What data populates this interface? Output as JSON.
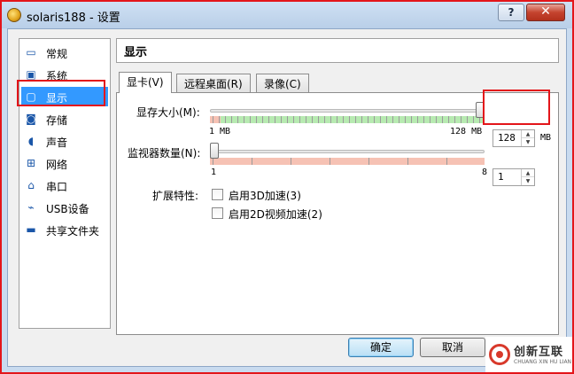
{
  "window": {
    "title": "solaris188 - 设置",
    "help_label": "?",
    "close_label": "✕"
  },
  "sidebar": {
    "items": [
      {
        "label": "常规",
        "icon": "general-icon"
      },
      {
        "label": "系统",
        "icon": "system-icon"
      },
      {
        "label": "显示",
        "icon": "display-icon"
      },
      {
        "label": "存储",
        "icon": "storage-icon"
      },
      {
        "label": "声音",
        "icon": "audio-icon"
      },
      {
        "label": "网络",
        "icon": "network-icon"
      },
      {
        "label": "串口",
        "icon": "serial-port-icon"
      },
      {
        "label": "USB设备",
        "icon": "usb-icon"
      },
      {
        "label": "共享文件夹",
        "icon": "shared-folder-icon"
      }
    ],
    "selected": "显示"
  },
  "page": {
    "title": "显示"
  },
  "tabs": [
    {
      "label": "显卡(V)",
      "active": true
    },
    {
      "label": "远程桌面(R)",
      "active": false
    },
    {
      "label": "录像(C)",
      "active": false
    }
  ],
  "video_memory": {
    "label": "显存大小(M):",
    "value": "128",
    "unit": "MB",
    "min_label": "1  MB",
    "max_label": "128  MB",
    "level": 1.0
  },
  "monitors": {
    "label": "监视器数量(N):",
    "value": "1",
    "min_label": "1",
    "max_label": "8",
    "level": 0.0
  },
  "extended": {
    "label": "扩展特性:",
    "options": [
      {
        "label": "启用3D加速(3)",
        "checked": false
      },
      {
        "label": "启用2D视频加速(2)",
        "checked": false
      }
    ]
  },
  "buttons": {
    "ok": "确定",
    "cancel": "取消"
  },
  "watermark": {
    "text": "创新互联",
    "sub": "CHUANG XIN HU LIAN"
  },
  "colors": {
    "accent": "#3399ff",
    "highlight_red": "#e3151a",
    "good_range": "#b7eab1",
    "bad_range": "#f6c2b4"
  }
}
